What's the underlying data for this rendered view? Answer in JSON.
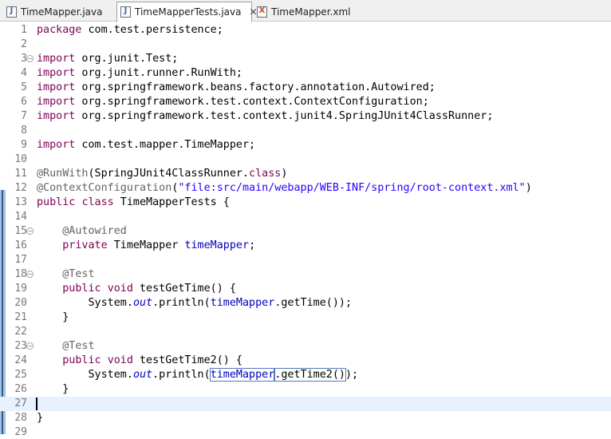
{
  "tabs": [
    {
      "label": "TimeMapper.java",
      "icon": "java-file-icon",
      "glyph": "J",
      "active": false
    },
    {
      "label": "TimeMapperTests.java",
      "icon": "java-file-icon",
      "glyph": "J",
      "active": true
    },
    {
      "label": "TimeMapper.xml",
      "icon": "xml-file-icon",
      "glyph": "X",
      "active": false
    }
  ],
  "colors": {
    "keyword": "#7f0055",
    "annotation": "#646464",
    "string": "#2a00ff",
    "field": "#0000c0",
    "current_line": "#e8f2fe"
  },
  "editor": {
    "current_line": 27,
    "lines": [
      {
        "n": "1",
        "segments": [
          [
            "kw",
            "package"
          ],
          [
            "t",
            " com.test.persistence;"
          ]
        ]
      },
      {
        "n": "2",
        "segments": []
      },
      {
        "n": "3",
        "fold": true,
        "segments": [
          [
            "kw",
            "import"
          ],
          [
            "t",
            " org.junit.Test;"
          ]
        ]
      },
      {
        "n": "4",
        "segments": [
          [
            "kw",
            "import"
          ],
          [
            "t",
            " org.junit.runner.RunWith;"
          ]
        ]
      },
      {
        "n": "5",
        "segments": [
          [
            "kw",
            "import"
          ],
          [
            "t",
            " org.springframework.beans.factory.annotation.Autowired;"
          ]
        ]
      },
      {
        "n": "6",
        "segments": [
          [
            "kw",
            "import"
          ],
          [
            "t",
            " org.springframework.test.context.ContextConfiguration;"
          ]
        ]
      },
      {
        "n": "7",
        "segments": [
          [
            "kw",
            "import"
          ],
          [
            "t",
            " org.springframework.test.context.junit4.SpringJUnit4ClassRunner;"
          ]
        ]
      },
      {
        "n": "8",
        "segments": []
      },
      {
        "n": "9",
        "segments": [
          [
            "kw",
            "import"
          ],
          [
            "t",
            " com.test.mapper.TimeMapper;"
          ]
        ]
      },
      {
        "n": "10",
        "segments": []
      },
      {
        "n": "11",
        "segments": [
          [
            "an",
            "@RunWith"
          ],
          [
            "t",
            "(SpringJUnit4ClassRunner."
          ],
          [
            "kw",
            "class"
          ],
          [
            "t",
            ")"
          ]
        ]
      },
      {
        "n": "12",
        "segments": [
          [
            "an",
            "@ContextConfiguration"
          ],
          [
            "t",
            "("
          ],
          [
            "str",
            "\"file:src/main/webapp/WEB-INF/spring/root-context.xml\""
          ],
          [
            "t",
            ")"
          ]
        ]
      },
      {
        "n": "13",
        "segments": [
          [
            "kw",
            "public"
          ],
          [
            "t",
            " "
          ],
          [
            "kw",
            "class"
          ],
          [
            "t",
            " TimeMapperTests {"
          ]
        ]
      },
      {
        "n": "14",
        "segments": []
      },
      {
        "n": "15",
        "fold": true,
        "segments": [
          [
            "t",
            "    "
          ],
          [
            "an",
            "@Autowired"
          ]
        ]
      },
      {
        "n": "16",
        "segments": [
          [
            "t",
            "    "
          ],
          [
            "kw",
            "private"
          ],
          [
            "t",
            " TimeMapper "
          ],
          [
            "fld",
            "timeMapper"
          ],
          [
            "t",
            ";"
          ]
        ]
      },
      {
        "n": "17",
        "segments": []
      },
      {
        "n": "18",
        "fold": true,
        "segments": [
          [
            "t",
            "    "
          ],
          [
            "an",
            "@Test"
          ]
        ]
      },
      {
        "n": "19",
        "segments": [
          [
            "t",
            "    "
          ],
          [
            "kw",
            "public"
          ],
          [
            "t",
            " "
          ],
          [
            "kw",
            "void"
          ],
          [
            "t",
            " testGetTime() {"
          ]
        ]
      },
      {
        "n": "20",
        "segments": [
          [
            "t",
            "        System."
          ],
          [
            "sfld",
            "out"
          ],
          [
            "t",
            ".println("
          ],
          [
            "fld",
            "timeMapper"
          ],
          [
            "t",
            ".getTime());"
          ]
        ]
      },
      {
        "n": "21",
        "segments": [
          [
            "t",
            "    }"
          ]
        ]
      },
      {
        "n": "22",
        "segments": []
      },
      {
        "n": "23",
        "fold": true,
        "segments": [
          [
            "t",
            "    "
          ],
          [
            "an",
            "@Test"
          ]
        ]
      },
      {
        "n": "24",
        "segments": [
          [
            "t",
            "    "
          ],
          [
            "kw",
            "public"
          ],
          [
            "t",
            " "
          ],
          [
            "kw",
            "void"
          ],
          [
            "t",
            " testGetTime2() {"
          ]
        ]
      },
      {
        "n": "25",
        "segments": [
          [
            "t",
            "        System."
          ],
          [
            "sfld",
            "out"
          ],
          [
            "t",
            ".println("
          ],
          [
            "hlfld",
            "timeMapper"
          ],
          [
            "hl",
            ".getTime2()"
          ],
          [
            "t",
            ");"
          ]
        ]
      },
      {
        "n": "26",
        "segments": [
          [
            "t",
            "    }"
          ]
        ]
      },
      {
        "n": "27",
        "segments": []
      },
      {
        "n": "28",
        "segments": [
          [
            "t",
            "}"
          ]
        ]
      },
      {
        "n": "29",
        "segments": []
      }
    ]
  }
}
